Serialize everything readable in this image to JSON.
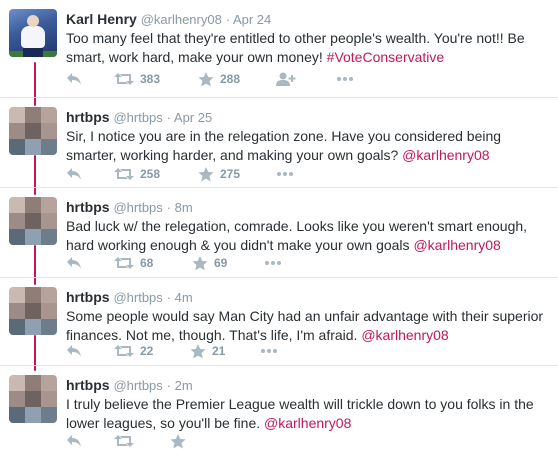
{
  "tweets": [
    {
      "name": "Karl Henry",
      "handle": "@karlhenry08",
      "time": "· Apr 24",
      "text": "Too many feel that they're entitled to other people's wealth. You're not!! Be smart, work hard, make your own money! ",
      "link": "#VoteConservative",
      "retweets": "383",
      "likes": "288"
    },
    {
      "name": "hrtbps",
      "handle": "@hrtbps",
      "time": "· Apr 25",
      "text": "Sir, I notice you are in the relegation zone. Have you considered being smarter, working harder, and making your own goals? ",
      "link": "@karlhenry08",
      "retweets": "258",
      "likes": "275"
    },
    {
      "name": "hrtbps",
      "handle": "@hrtbps",
      "time": "· 8m",
      "text": "Bad luck w/ the relegation, comrade. Looks like you weren't smart enough, hard working enough & you didn't make your own goals ",
      "link": "@karlhenry08",
      "retweets": "68",
      "likes": "69"
    },
    {
      "name": "hrtbps",
      "handle": "@hrtbps",
      "time": "· 4m",
      "text": "Some people would say Man City had an unfair advantage with their superior finances. Not me, though. That's life, I'm afraid. ",
      "link": "@karlhenry08",
      "retweets": "22",
      "likes": "21"
    },
    {
      "name": "hrtbps",
      "handle": "@hrtbps",
      "time": "· 2m",
      "text": "I truly believe the Premier League wealth will trickle down to you folks in the lower leagues, so you'll be fine. ",
      "link": "@karlhenry08",
      "retweets": "",
      "likes": ""
    }
  ],
  "icons": [
    "reply-icon",
    "retweet-icon",
    "like-star-icon",
    "follow-icon",
    "more-icon"
  ],
  "colors": {
    "accent": "#c2185b",
    "muted": "#8899a6",
    "text": "#292f33"
  }
}
